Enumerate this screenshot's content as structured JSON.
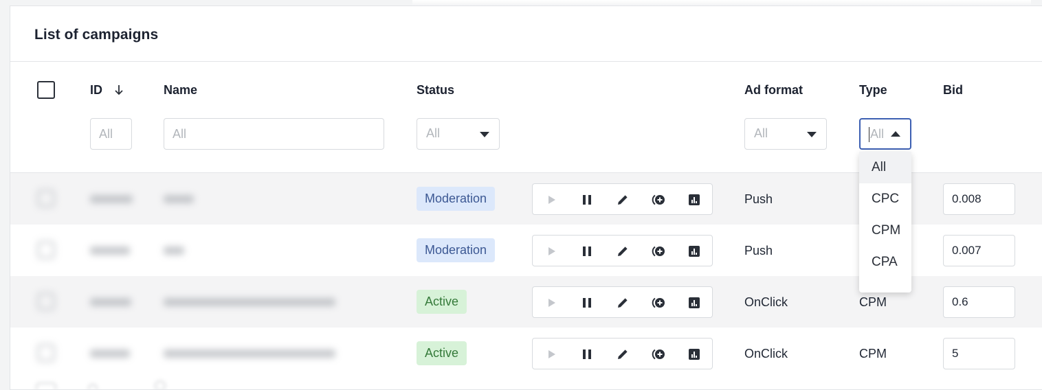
{
  "page": {
    "title": "List of campaigns"
  },
  "columns": {
    "id": "ID",
    "name": "Name",
    "status": "Status",
    "ad_format": "Ad format",
    "type": "Type",
    "bid": "Bid"
  },
  "filters": {
    "id_placeholder": "All",
    "name_placeholder": "All",
    "status_value": "All",
    "ad_format_value": "All",
    "type_value": "All"
  },
  "type_dropdown": {
    "open": true,
    "options": [
      "All",
      "CPC",
      "CPM",
      "CPA"
    ],
    "selected": "All"
  },
  "rows": [
    {
      "status": "Moderation",
      "ad_format": "Push",
      "type": "",
      "bid": "0.008"
    },
    {
      "status": "Moderation",
      "ad_format": "Push",
      "type": "",
      "bid": "0.007"
    },
    {
      "status": "Active",
      "ad_format": "OnClick",
      "type": "CPM",
      "bid": "0.6"
    },
    {
      "status": "Active",
      "ad_format": "OnClick",
      "type": "CPM",
      "bid": "5"
    }
  ],
  "action_icons": [
    "play-icon",
    "pause-icon",
    "edit-icon",
    "add-circle-icon",
    "stats-icon"
  ],
  "colors": {
    "moderation_bg": "#dce8fb",
    "moderation_text": "#3c5893",
    "active_bg": "#d7f2d8",
    "active_text": "#357a3a",
    "focus_border": "#3c5fb2"
  }
}
